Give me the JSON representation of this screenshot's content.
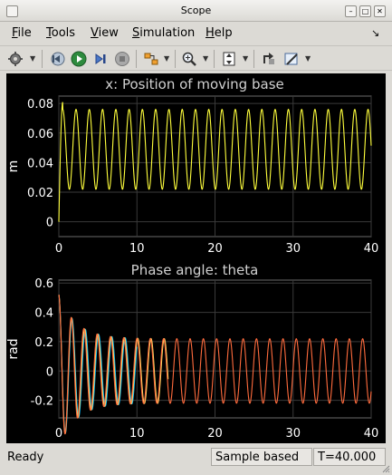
{
  "window": {
    "title": "Scope"
  },
  "menu": {
    "items": [
      {
        "mnemonic": "F",
        "rest": "ile"
      },
      {
        "mnemonic": "T",
        "rest": "ools"
      },
      {
        "mnemonic": "V",
        "rest": "iew"
      },
      {
        "mnemonic": "S",
        "rest": "imulation"
      },
      {
        "mnemonic": "H",
        "rest": "elp"
      }
    ]
  },
  "toolbar": {
    "icons": [
      "settings-icon",
      "step-back-icon",
      "run-icon",
      "step-forward-icon",
      "stop-icon",
      "highlight-block-icon",
      "zoom-icon",
      "autoscale-icon",
      "restore-icon",
      "style-icon"
    ]
  },
  "colors": {
    "axes_bg": "#000000",
    "grid": "#3a3a3a",
    "axis_text": "#ffffff",
    "title_text": "#d0d0d0",
    "series_x": "#ffff3c",
    "series_theta_1": "#00b8ff",
    "series_theta_2": "#ffe066",
    "series_theta_3": "#ff6b3d"
  },
  "chart_data": [
    {
      "type": "line",
      "title": "x: Position of moving base",
      "ylabel": "m",
      "xlim": [
        0,
        40
      ],
      "ylim": [
        -0.01,
        0.085
      ],
      "xticks": [
        0,
        10,
        20,
        30,
        40
      ],
      "yticks": [
        0,
        0.02,
        0.04,
        0.06,
        0.08
      ],
      "xtick_labels": [
        "0",
        "10",
        "20",
        "30",
        "40"
      ],
      "ytick_labels": [
        "0",
        "0.02",
        "0.04",
        "0.06",
        "0.08"
      ],
      "grid": true,
      "signal": {
        "offset": 0.049,
        "amplitude": 0.027,
        "period": 1.7,
        "first_peak": 0.081,
        "x_start": 0
      },
      "series": [
        {
          "color": "#ffff3c"
        }
      ]
    },
    {
      "type": "line",
      "title": "Phase angle: theta",
      "ylabel": "rad",
      "xlim": [
        0,
        40
      ],
      "ylim": [
        -0.32,
        0.62
      ],
      "xticks": [
        0,
        10,
        20,
        30,
        40
      ],
      "yticks": [
        -0.2,
        0,
        0.2,
        0.4,
        0.6
      ],
      "xtick_labels": [
        "0",
        "10",
        "20",
        "30",
        "40"
      ],
      "ytick_labels": [
        "-0.2",
        "0",
        "0.2",
        "0.4",
        "0.6"
      ],
      "grid": true,
      "signal": {
        "initial": 0.52,
        "steady_amplitude": 0.22,
        "period": 1.7
      },
      "series": [
        {
          "color": "#00b8ff",
          "decay_end": 10
        },
        {
          "color": "#ffe066",
          "decay_end": 14
        },
        {
          "color": "#ff6b3d",
          "decay_end": 40
        }
      ]
    }
  ],
  "status": {
    "ready": "Ready",
    "mode": "Sample based",
    "time": "T=40.000"
  }
}
